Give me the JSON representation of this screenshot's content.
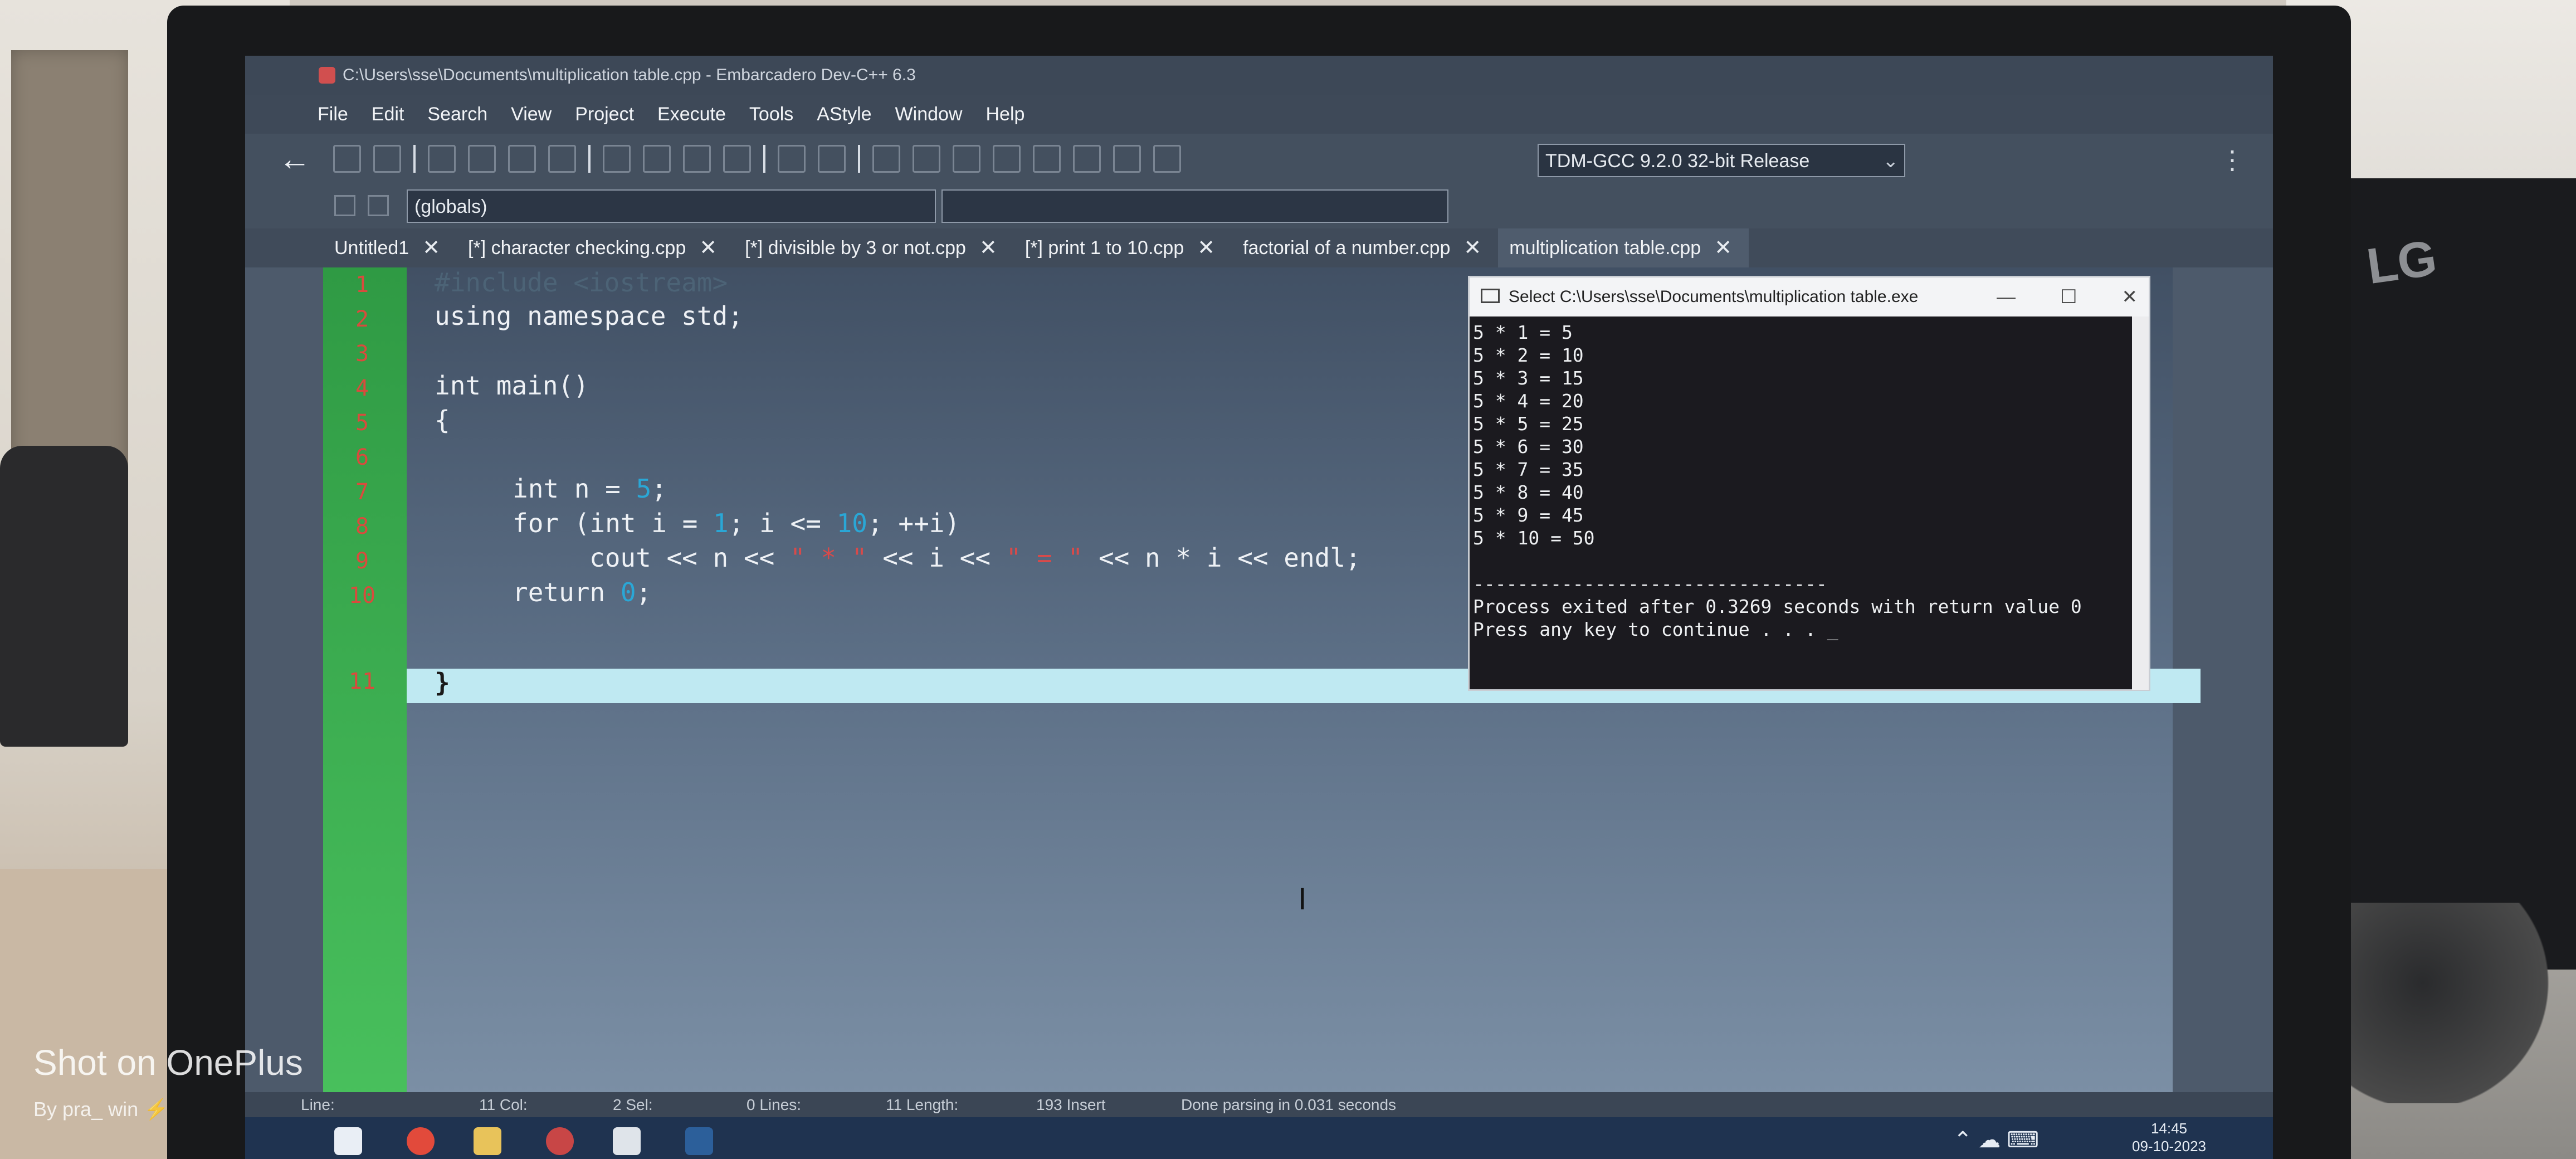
{
  "window_title": "C:\\Users\\sse\\Documents\\multiplication table.cpp - Embarcadero Dev-C++ 6.3",
  "menu": [
    "File",
    "Edit",
    "Search",
    "View",
    "Project",
    "Execute",
    "Tools",
    "AStyle",
    "Window",
    "Help"
  ],
  "toolbar": {
    "compiler_selected": "TDM-GCC 9.2.0 32-bit Release",
    "scope_selected": "(globals)"
  },
  "tabs": [
    {
      "label": "Untitled1"
    },
    {
      "label": "[*] character checking.cpp"
    },
    {
      "label": "[*] divisible by 3 or not.cpp"
    },
    {
      "label": "[*] print 1 to 10.cpp"
    },
    {
      "label": "factorial of a number.cpp"
    },
    {
      "label": "multiplication table.cpp"
    }
  ],
  "editor": {
    "line_numbers": [
      "1",
      "2",
      "3",
      "4",
      "5",
      "6",
      "7",
      "8",
      "9",
      "10",
      "11"
    ],
    "l1": "#include <iostream>",
    "l2": "using namespace std;",
    "l4": "int main()",
    "l5": "{",
    "l7a": "int n = ",
    "l7n": "5",
    "l7b": ";",
    "l8a": "for (int i = ",
    "l8n1": "1",
    "l8b": "; i <= ",
    "l8n2": "10",
    "l8c": "; ++i)",
    "l9a": "cout << n << ",
    "l9s1": "\" * \"",
    "l9b": " << i << ",
    "l9s2": "\" = \"",
    "l9c": " << n * i << endl;",
    "l10a": "return ",
    "l10n": "0",
    "l10b": ";",
    "l11": "}"
  },
  "console": {
    "title": "Select C:\\Users\\sse\\Documents\\multiplication table.exe",
    "lines": [
      "5 * 1 = 5",
      "5 * 2 = 10",
      "5 * 3 = 15",
      "5 * 4 = 20",
      "5 * 5 = 25",
      "5 * 6 = 30",
      "5 * 7 = 35",
      "5 * 8 = 40",
      "5 * 9 = 45",
      "5 * 10 = 50",
      "",
      "--------------------------------",
      "Process exited after 0.3269 seconds with return value 0",
      "Press any key to continue . . . _"
    ]
  },
  "status": {
    "line": "Line:",
    "col": "11 Col:",
    "sel": "2 Sel:",
    "lines": "0 Lines:",
    "length": "11 Length:",
    "insert": "193 Insert",
    "message": "Done parsing in 0.031 seconds"
  },
  "taskbar": {
    "time": "14:45",
    "date": "09-10-2023"
  },
  "watermark": {
    "line1": "Shot on OnePlus",
    "line2": "By pra_  win ⚡"
  }
}
